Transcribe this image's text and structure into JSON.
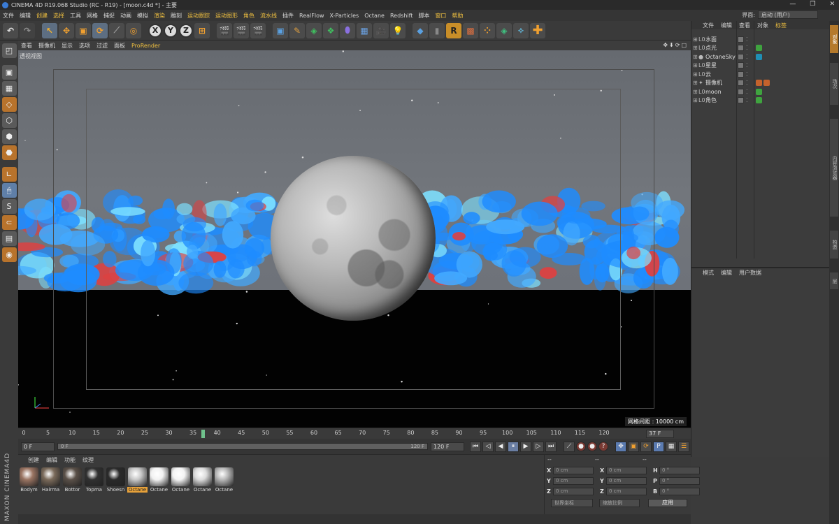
{
  "window": {
    "title": "CINEMA 4D R19.068 Studio (RC - R19) - [moon.c4d *] - 主要",
    "controls": [
      "—",
      "❐",
      "✕"
    ]
  },
  "menubar": {
    "items": [
      "文件",
      "编辑",
      "创建",
      "选择",
      "工具",
      "网格",
      "捕捉",
      "动画",
      "模拟",
      "渲染",
      "雕刻",
      "运动跟踪",
      "运动图形",
      "角色",
      "流水线",
      "插件",
      "RealFlow",
      "X-Particles",
      "Octane",
      "Redshift",
      "脚本",
      "窗口",
      "帮助"
    ],
    "highlighted": [
      "创建",
      "选择",
      "渲染",
      "运动跟踪",
      "运动图形",
      "角色",
      "流水线",
      "窗口",
      "帮助"
    ],
    "layout_label": "界面:",
    "layout_value": "启动 (用户)"
  },
  "toolbar": {
    "undo_icon": "undo-icon",
    "axes": [
      "X",
      "Y",
      "Z"
    ]
  },
  "viewport": {
    "menu": [
      "查看",
      "摄像机",
      "显示",
      "选项",
      "过滤",
      "面板",
      "ProRender"
    ],
    "active_menu": "ProRender",
    "view_name": "透视视图",
    "grid_readout": "网格间距 : 10000 cm",
    "colors": {
      "sky": "#6c7076",
      "ground": "#020202",
      "cloud": "#1e8cff"
    }
  },
  "timeline": {
    "ticks": [
      0,
      5,
      10,
      15,
      20,
      25,
      30,
      35,
      40,
      45,
      50,
      55,
      60,
      65,
      70,
      75,
      80,
      85,
      90,
      95,
      100,
      105,
      110,
      115,
      120
    ],
    "current_frame": 37,
    "current_frame_label": "37 F"
  },
  "transport": {
    "start": "0 F",
    "range_start": "0 F",
    "range_end": "120 F",
    "end": "120 F"
  },
  "materials": {
    "menu": [
      "创建",
      "编辑",
      "功能",
      "纹理"
    ],
    "items": [
      {
        "name": "Bodym",
        "color": "#9a7462"
      },
      {
        "name": "Hairma",
        "color": "#7a6a5a"
      },
      {
        "name": "Bottor",
        "color": "#5a5048"
      },
      {
        "name": "Topma",
        "color": "#303030"
      },
      {
        "name": "Shoesn",
        "color": "#2a2a2a"
      },
      {
        "name": "Octane",
        "color": "#c8c8c8"
      },
      {
        "name": "Octane",
        "color": "#f2f2f2"
      },
      {
        "name": "Octane",
        "color": "#f4f4f4"
      },
      {
        "name": "Octane",
        "color": "#dcdcdc"
      },
      {
        "name": "Octane",
        "color": "#b8b8b8"
      }
    ],
    "selected_index": 5,
    "brand": "MAXON CINEMA4D"
  },
  "coordinates": {
    "header": [
      "--",
      "--",
      "--"
    ],
    "rows": [
      {
        "a": "X",
        "av": "0 cm",
        "b": "X",
        "bv": "0 cm",
        "c": "H",
        "cv": "0 °"
      },
      {
        "a": "Y",
        "av": "0 cm",
        "b": "Y",
        "bv": "0 cm",
        "c": "P",
        "cv": "0 °"
      },
      {
        "a": "Z",
        "av": "0 cm",
        "b": "Z",
        "bv": "0 cm",
        "c": "B",
        "cv": "0 °"
      }
    ],
    "space": "世界坐标",
    "scale": "缩放比例",
    "apply": "应用"
  },
  "objects": {
    "menu": [
      "文件",
      "编辑",
      "查看",
      "对象",
      "标签"
    ],
    "active_menu": "标签",
    "items": [
      {
        "name": "水面",
        "icon": "L0",
        "tags": []
      },
      {
        "name": "点光",
        "icon": "L0",
        "tags": [
          "green"
        ]
      },
      {
        "name": "OctaneSky",
        "icon": "●",
        "tags": [
          "cyan"
        ]
      },
      {
        "name": "星星",
        "icon": "L0",
        "tags": []
      },
      {
        "name": "云",
        "icon": "L0",
        "tags": []
      },
      {
        "name": "摄像机",
        "icon": "✦",
        "tags": [
          "orange",
          "orange"
        ]
      },
      {
        "name": "moon",
        "icon": "L0",
        "tags": [
          "green"
        ]
      },
      {
        "name": "角色",
        "icon": "L0",
        "tags": [
          "green"
        ]
      }
    ]
  },
  "attributes": {
    "menu": [
      "模式",
      "编辑",
      "用户数据"
    ]
  },
  "side_tabs": [
    "对象",
    "场次",
    "内容浏览器",
    "构造",
    "层"
  ]
}
